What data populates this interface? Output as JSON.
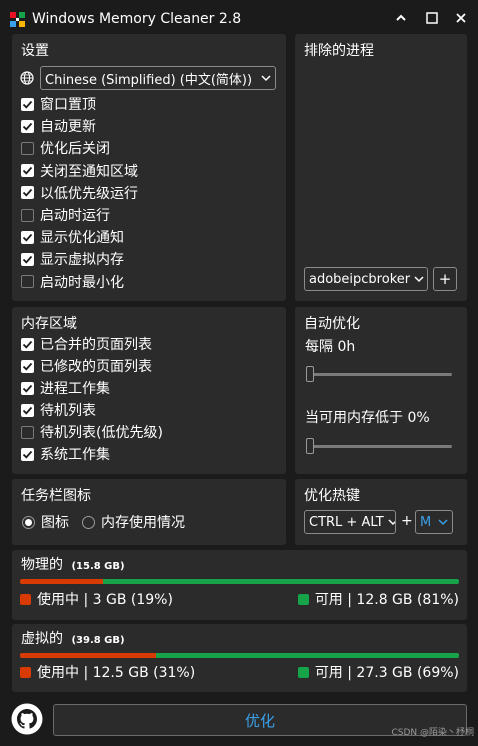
{
  "window": {
    "title": "Windows Memory Cleaner 2.8",
    "minimize_glyph": "⌃",
    "maximize_glyph": "▫",
    "close_glyph": "✕"
  },
  "settings": {
    "title": "设置",
    "language": "Chinese (Simplified) (中文(简体))",
    "options": [
      {
        "label": "窗口置顶",
        "checked": true
      },
      {
        "label": "自动更新",
        "checked": true
      },
      {
        "label": "优化后关闭",
        "checked": false
      },
      {
        "label": "关闭至通知区域",
        "checked": true
      },
      {
        "label": "以低优先级运行",
        "checked": true
      },
      {
        "label": "启动时运行",
        "checked": false
      },
      {
        "label": "显示优化通知",
        "checked": true
      },
      {
        "label": "显示虚拟内存",
        "checked": true
      },
      {
        "label": "启动时最小化",
        "checked": false
      }
    ]
  },
  "excluded": {
    "title": "排除的进程",
    "process": "adobeipcbroker",
    "add_label": "+"
  },
  "memory_areas": {
    "title": "内存区域",
    "options": [
      {
        "label": "已合并的页面列表",
        "checked": true
      },
      {
        "label": "已修改的页面列表",
        "checked": true
      },
      {
        "label": "进程工作集",
        "checked": true
      },
      {
        "label": "待机列表",
        "checked": true
      },
      {
        "label": "待机列表(低优先级)",
        "checked": false
      },
      {
        "label": "系统工作集",
        "checked": true
      }
    ]
  },
  "auto_optimize": {
    "title": "自动优化",
    "interval_label": "每隔 0h",
    "interval_value": 0,
    "threshold_label": "当可用内存低于 0%",
    "threshold_value": 0
  },
  "tray_icon": {
    "title": "任务栏图标",
    "option_icon": "图标",
    "option_usage": "内存使用情况",
    "selected": "icon"
  },
  "hotkey": {
    "title": "优化热键",
    "modifier": "CTRL + ALT",
    "plus": "+",
    "key": "M"
  },
  "physical": {
    "title": "物理的",
    "total": "(15.8 GB)",
    "used_label": "使用中 | 3 GB (19%)",
    "free_label": "可用 | 12.8 GB (81%)",
    "used_percent": 19
  },
  "virtual": {
    "title": "虚拟的",
    "total": "(39.8 GB)",
    "used_label": "使用中 | 12.5 GB (31%)",
    "free_label": "可用 | 27.3 GB (69%)",
    "used_percent": 31
  },
  "colors": {
    "used": "#d83b01",
    "free": "#16a34a",
    "accent": "#3aa0e8",
    "panel": "#2b2b2b",
    "background": "#1b1b1b"
  },
  "footer": {
    "optimize_label": "优化",
    "github_icon": "github-icon",
    "watermark": "CSDN @陌染丶杼桐"
  }
}
